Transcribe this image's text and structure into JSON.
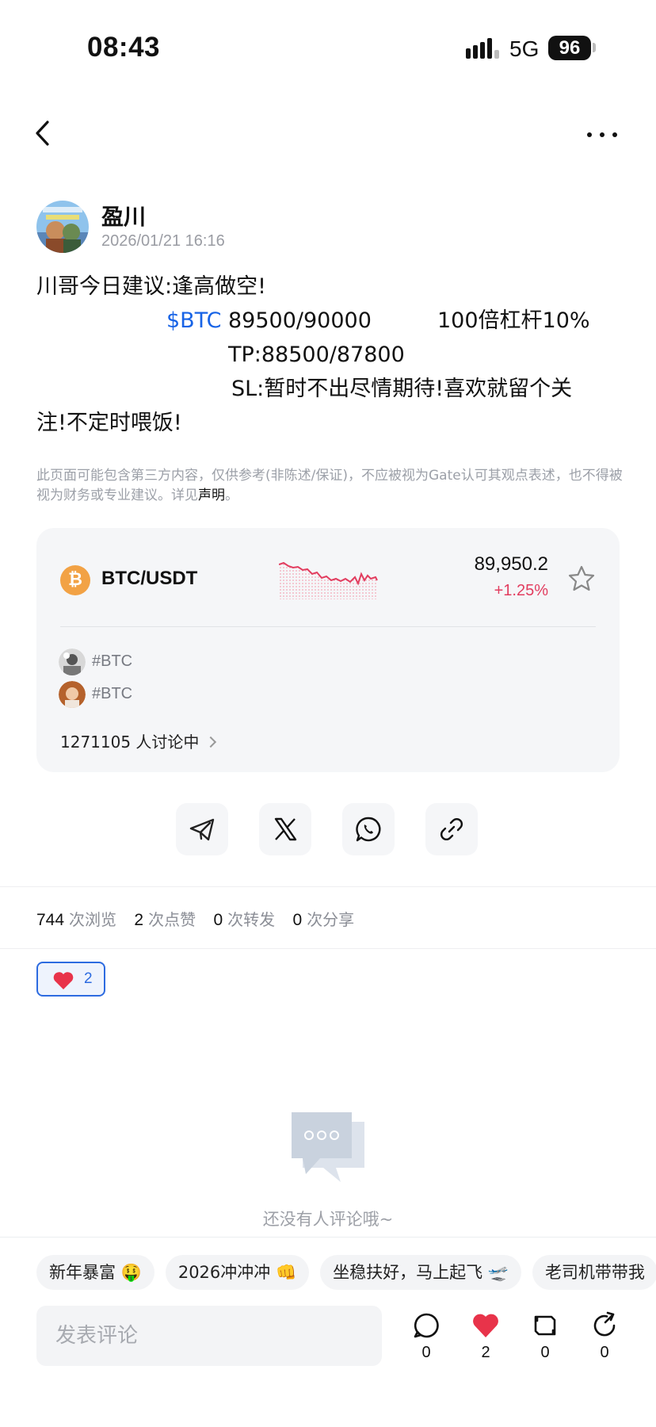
{
  "status_bar": {
    "time": "08:43",
    "network": "5G",
    "battery": "96"
  },
  "nav": {
    "back_icon": "chevron-left-icon",
    "more_icon": "more-horizontal-icon"
  },
  "author": {
    "name": "盈川",
    "timestamp": "2026/01/21 16:16"
  },
  "post": {
    "line1": "川哥今日建议:逢高做空!",
    "tag": "$BTC",
    "entry": "89500/90000",
    "leverage": "100倍杠杆10%",
    "tp": "TP:88500/87800",
    "sl": "SL:暂时不出尽情期待!喜欢就留个关",
    "line5": "注!不定时喂饭!"
  },
  "disclaimer": {
    "text_before": "此页面可能包含第三方内容，仅供参考(非陈述/保证)，不应被视为Gate认可其观点表述，也不得被视为财务或专业建议。详见",
    "link": "声明",
    "text_after": "。"
  },
  "market_card": {
    "coin_symbol": "₿",
    "pair": "BTC/USDT",
    "price": "89,950.2",
    "change": "+1.25%",
    "star_icon": "star-outline-icon",
    "topics": [
      {
        "label": "#BTC"
      },
      {
        "label": "#BTC"
      }
    ],
    "discussing": "1271105 人讨论中"
  },
  "share_buttons": [
    "telegram-icon",
    "x-icon",
    "whatsapp-icon",
    "link-icon"
  ],
  "stats": {
    "views": "744",
    "views_label": "次浏览",
    "likes": "2",
    "likes_label": "次点赞",
    "reposts": "0",
    "reposts_label": "次转发",
    "shares": "0",
    "shares_label": "次分享"
  },
  "reaction": {
    "count": "2",
    "color": "#e8334a"
  },
  "empty_state": {
    "text": "还没有人评论哦~"
  },
  "quick_chips": [
    "新年暴富 🤑",
    "2026冲冲冲 👊",
    "坐稳扶好，马上起飞 🛫",
    "老司机带带我"
  ],
  "comment_box": {
    "placeholder": "发表评论"
  },
  "actions": {
    "comments": "0",
    "likes": "2",
    "reposts": "0",
    "shares": "0"
  },
  "colors": {
    "accent": "#1763e6",
    "down": "#e23d5f",
    "btc": "#f2a245"
  }
}
